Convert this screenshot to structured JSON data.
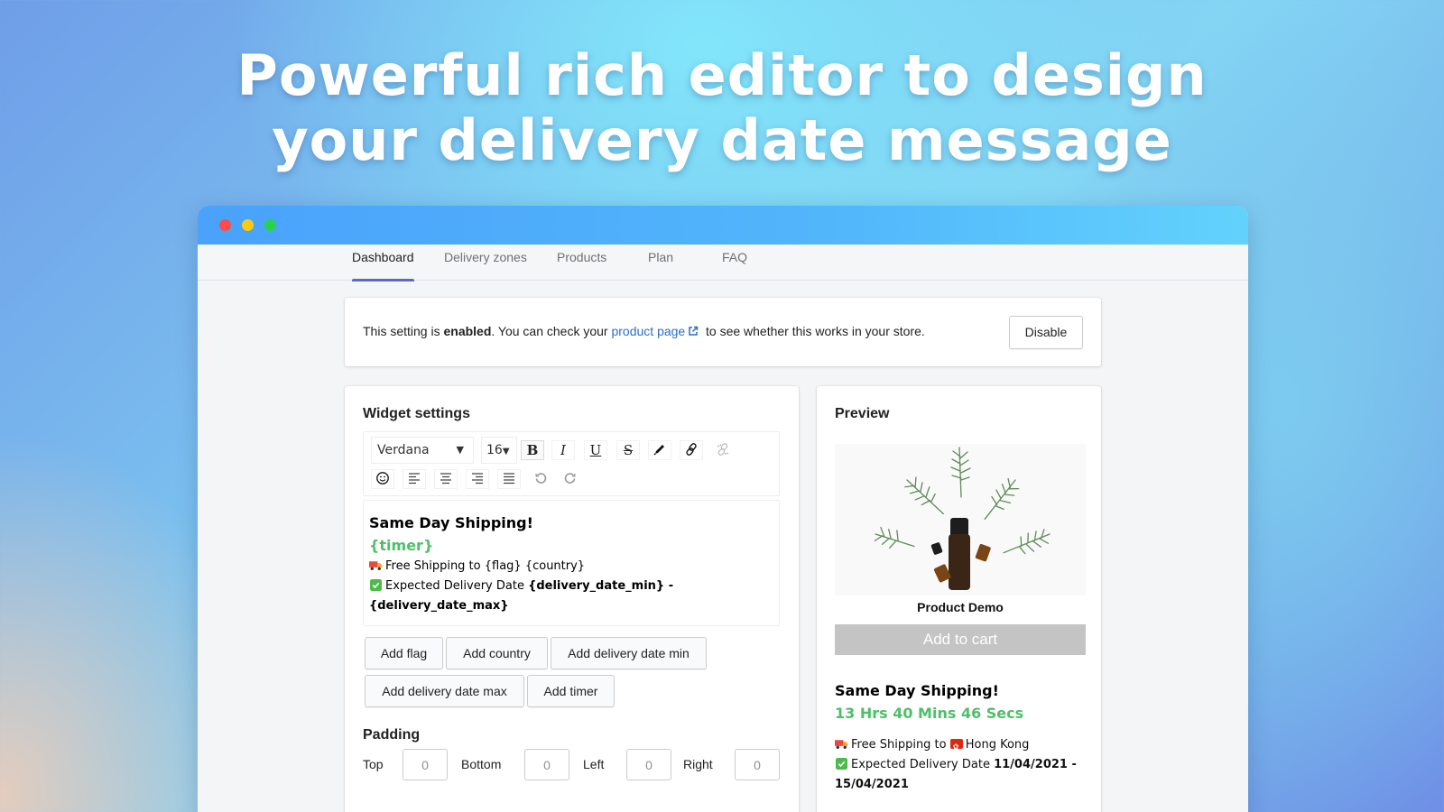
{
  "hero": {
    "line1": "Powerful rich editor to design",
    "line2": "your delivery date message"
  },
  "window": {
    "traffic_lights": [
      "close",
      "minimize",
      "maximize"
    ]
  },
  "nav": {
    "tabs": [
      {
        "label": "Dashboard",
        "active": true
      },
      {
        "label": "Delivery zones",
        "active": false
      },
      {
        "label": "Products",
        "active": false
      },
      {
        "label": "Plan",
        "active": false
      },
      {
        "label": "FAQ",
        "active": false
      }
    ]
  },
  "status": {
    "prefix": "This setting is ",
    "state": "enabled",
    "middle": ". You can check your ",
    "link_text": "product page",
    "suffix": " to see whether this works in your store.",
    "button": "Disable"
  },
  "widget": {
    "title": "Widget settings",
    "toolbar": {
      "font": "Verdana",
      "size": "16",
      "buttons": [
        "bold",
        "italic",
        "underline",
        "strikethrough",
        "text-color",
        "link",
        "unlink",
        "emoji",
        "align-left",
        "align-center",
        "align-right",
        "justify",
        "undo",
        "redo"
      ]
    },
    "editor": {
      "heading": "Same Day Shipping!",
      "timer": "{timer}",
      "line1": "Free Shipping to {flag} {country}",
      "line2_prefix": "Expected Delivery Date ",
      "line2_bold": "{delivery_date_min} -",
      "line3_bold": "{delivery_date_max}"
    },
    "token_buttons": [
      "Add flag",
      "Add country",
      "Add delivery date min",
      "Add delivery date max",
      "Add timer"
    ],
    "padding": {
      "label": "Padding",
      "fields": [
        {
          "label": "Top",
          "value": "0"
        },
        {
          "label": "Bottom",
          "value": "0"
        },
        {
          "label": "Left",
          "value": "0"
        },
        {
          "label": "Right",
          "value": "0"
        }
      ]
    }
  },
  "preview": {
    "title": "Preview",
    "product_name": "Product Demo",
    "add_to_cart": "Add to cart",
    "heading": "Same Day Shipping!",
    "timer": "13 Hrs 40 Mins 46 Secs",
    "shipping_prefix": "Free Shipping to ",
    "country": "Hong Kong",
    "delivery_prefix": "Expected Delivery Date ",
    "delivery_range": "11/04/2021 - 15/04/2021"
  },
  "colors": {
    "accent": "#5c6ac4",
    "link": "#2c6ecb",
    "timer_green": "#4fbf6a",
    "titlebar": "#4aa2fb"
  }
}
